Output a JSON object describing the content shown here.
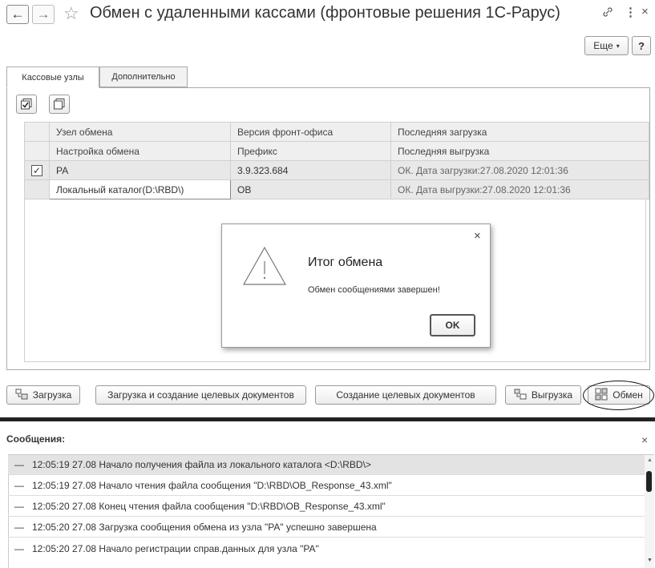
{
  "window": {
    "back_glyph": "←",
    "forward_glyph": "→",
    "title": "Обмен с удаленными кассами (фронтовые решения 1С-Рарус)",
    "more_label": "Еще",
    "help_label": "?",
    "link_glyph": "🔗",
    "menu_glyph": "⋮",
    "close_glyph": "×"
  },
  "tabs": [
    {
      "label": "Кассовые узлы",
      "active": true
    },
    {
      "label": "Дополнительно",
      "active": false
    }
  ],
  "table": {
    "header1": [
      "Узел обмена",
      "Версия фронт-офиса",
      "Последняя загрузка"
    ],
    "header2": [
      "Настройка обмена",
      "Префикс",
      "Последняя выгрузка"
    ],
    "rows": [
      {
        "checked": true,
        "check_glyph": "✓",
        "node": "РА",
        "version": "3.9.323.684",
        "status": "ОК. Дата загрузки:27.08.2020 12:01:36"
      },
      {
        "checked": false,
        "check_glyph": "",
        "node": "Локальный каталог(D:\\RBD\\)",
        "version": "ОВ",
        "status": "ОК. Дата выгрузки:27.08.2020 12:01:36"
      }
    ]
  },
  "dialog": {
    "title": "Итог обмена",
    "message": "Обмен сообщениями завершен!",
    "ok_label": "OK",
    "close_glyph": "×",
    "warning_glyph": "!"
  },
  "actions": {
    "load": "Загрузка",
    "load_create": "Загрузка и создание целевых документов",
    "create": "Создание целевых документов",
    "unload": "Выгрузка",
    "exchange": "Обмен"
  },
  "messages": {
    "title": "Сообщения:",
    "close_glyph": "×",
    "dash_glyph": "—",
    "items": [
      "12:05:19 27.08 Начало получения файла из локального каталога <D:\\RBD\\>",
      "12:05:19 27.08 Начало чтения файла сообщения \"D:\\RBD\\OB_Response_43.xml\"",
      "12:05:20 27.08 Конец чтения файла сообщения \"D:\\RBD\\OB_Response_43.xml\"",
      "12:05:20 27.08 Загрузка сообщения обмена из узла \"РА\" успешно завершена",
      "12:05:20 27.08 Начало регистрации справ.данных для узла \"РА\""
    ]
  }
}
